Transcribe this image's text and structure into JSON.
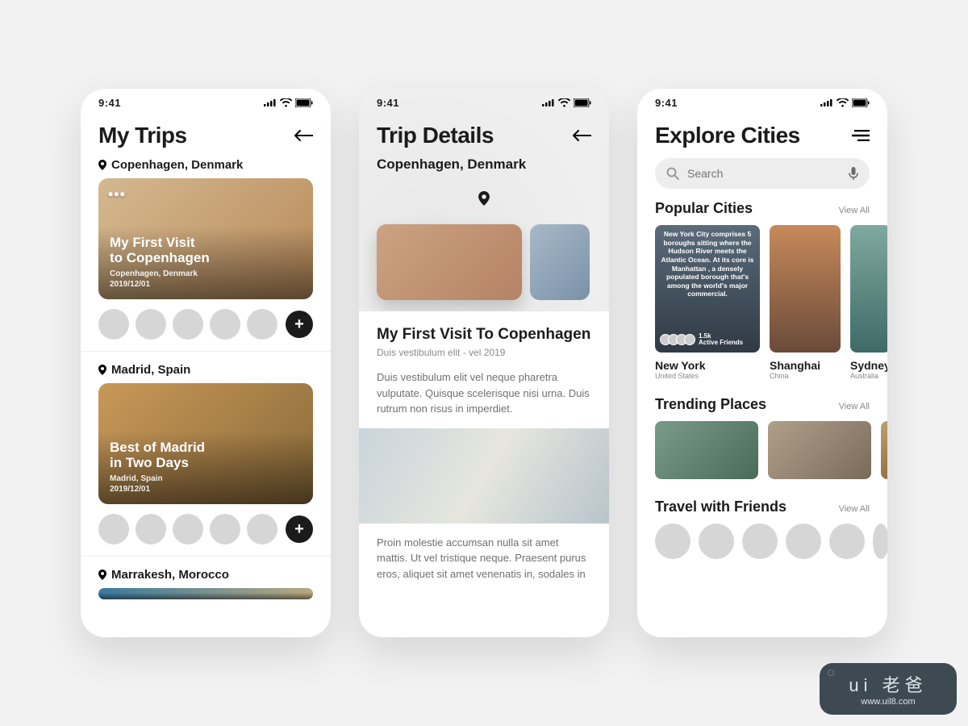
{
  "status": {
    "time": "9:41"
  },
  "screen1": {
    "title": "My Trips",
    "trips": [
      {
        "location": "Copenhagen, Denmark",
        "title": "My First Visit\nto Copenhagen",
        "sub_location": "Copenhagen, Denmark",
        "date": "2019/12/01"
      },
      {
        "location": "Madrid, Spain",
        "title": "Best of Madrid\nin Two Days",
        "sub_location": "Madrid, Spain",
        "date": "2019/12/01"
      },
      {
        "location": "Marrakesh, Morocco"
      }
    ]
  },
  "screen2": {
    "title": "Trip Details",
    "location": "Copenhagen, Denmark",
    "article_title": "My First Visit To Copenhagen",
    "article_meta": "Duis vestibulum elit - vel 2019",
    "para1": "Duis vestibulum elit vel neque pharetra vulputate. Quisque scelerisque nisi urna. Duis rutrum non risus in imperdiet.",
    "para2": "Proin molestie accumsan nulla sit amet mattis. Ut vel tristique neque. Praesent purus eros, aliquet sit amet venenatis in, sodales in"
  },
  "screen3": {
    "title": "Explore Cities",
    "search_placeholder": "Search",
    "popular_heading": "Popular Cities",
    "view_all": "View All",
    "ny_overlay": "New York City comprises 5 boroughs sitting where the Hudson River meets the Atlantic Ocean. At its core is Manhattan , a densely populated borough that's among the world's major commercial.",
    "ny_badge_count": "1.5k",
    "ny_badge_label": "Active Friends",
    "cities": [
      {
        "name": "New York",
        "country": "United States"
      },
      {
        "name": "Shanghai",
        "country": "China"
      },
      {
        "name": "Sydney",
        "country": "Australia"
      }
    ],
    "trending_heading": "Trending Places",
    "friends_heading": "Travel with Friends"
  },
  "watermark": {
    "brand": "ui 老爸",
    "url": "www.uil8.com"
  }
}
